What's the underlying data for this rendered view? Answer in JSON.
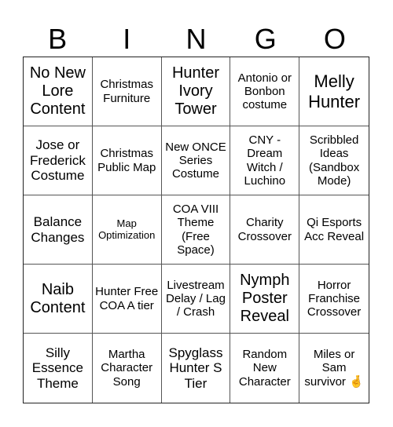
{
  "header": {
    "letters": [
      "B",
      "I",
      "N",
      "G",
      "O"
    ]
  },
  "cells": [
    {
      "text": "No New Lore Content",
      "size": "s-l"
    },
    {
      "text": "Christmas Furniture",
      "size": "s-s"
    },
    {
      "text": "Hunter Ivory Tower",
      "size": "s-l"
    },
    {
      "text": "Antonio or Bonbon costume",
      "size": "s-s"
    },
    {
      "text": "Melly Hunter",
      "size": "s-xl"
    },
    {
      "text": "Jose or Frederick Costume",
      "size": "s-m"
    },
    {
      "text": "Christmas Public Map",
      "size": "s-s"
    },
    {
      "text": "New ONCE Series Costume",
      "size": "s-s"
    },
    {
      "text": "CNY - Dream Witch / Luchino",
      "size": "s-s"
    },
    {
      "text": "Scribbled Ideas (Sandbox Mode)",
      "size": "s-s"
    },
    {
      "text": "Balance Changes",
      "size": "s-m"
    },
    {
      "text": "Map Optimization",
      "size": "s-xs"
    },
    {
      "text": "COA VIII Theme (Free Space)",
      "size": "s-s"
    },
    {
      "text": "Charity Crossover",
      "size": "s-s"
    },
    {
      "text": "Qi Esports Acc Reveal",
      "size": "s-s"
    },
    {
      "text": "Naib Content",
      "size": "s-l"
    },
    {
      "text": "Hunter Free COA A tier",
      "size": "s-s"
    },
    {
      "text": "Livestream Delay / Lag / Crash",
      "size": "s-s"
    },
    {
      "text": "Nymph Poster Reveal",
      "size": "s-l"
    },
    {
      "text": "Horror Franchise Crossover",
      "size": "s-s"
    },
    {
      "text": "Silly Essence Theme",
      "size": "s-m"
    },
    {
      "text": "Martha Character Song",
      "size": "s-s"
    },
    {
      "text": "Spyglass Hunter S Tier",
      "size": "s-m"
    },
    {
      "text": "Random New Character",
      "size": "s-s"
    },
    {
      "text": "Miles or Sam survivor 🤞",
      "size": "s-s"
    }
  ]
}
